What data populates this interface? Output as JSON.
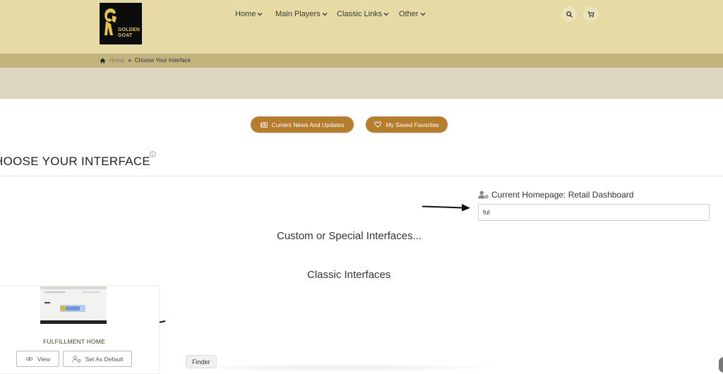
{
  "header": {
    "logo": {
      "line1": "GOLDEN",
      "line2": "GOAT"
    },
    "nav": [
      {
        "label": "Home"
      },
      {
        "label": "Main Players"
      },
      {
        "label": "Classic Links"
      },
      {
        "label": "Other"
      }
    ],
    "icons": {
      "search": "search-icon",
      "cart": "cart-icon"
    }
  },
  "breadcrumb": {
    "home": "Home",
    "current": "Choose Your Interface"
  },
  "actions": {
    "news_label": "Current News And Updates",
    "favorites_label": "My Saved Favorites"
  },
  "page": {
    "title": "HOOSE YOUR INTERFACE"
  },
  "homepage": {
    "label": "Current Homepage: Retail Dashboard",
    "filter_value": "ful"
  },
  "sections": {
    "custom": "Custom or Special Interfaces...",
    "classic": "Classic Interfaces"
  },
  "card": {
    "title": "FULFILLMENT HOME",
    "view_label": "View",
    "default_label": "Set As Default"
  },
  "tooltip": {
    "finder": "Finder"
  },
  "colors": {
    "header_bg": "#e6dba4",
    "breadcrumb_bg": "#c2b47d",
    "subbar_bg": "#dcd5c0",
    "accent": "#b57e2e"
  }
}
